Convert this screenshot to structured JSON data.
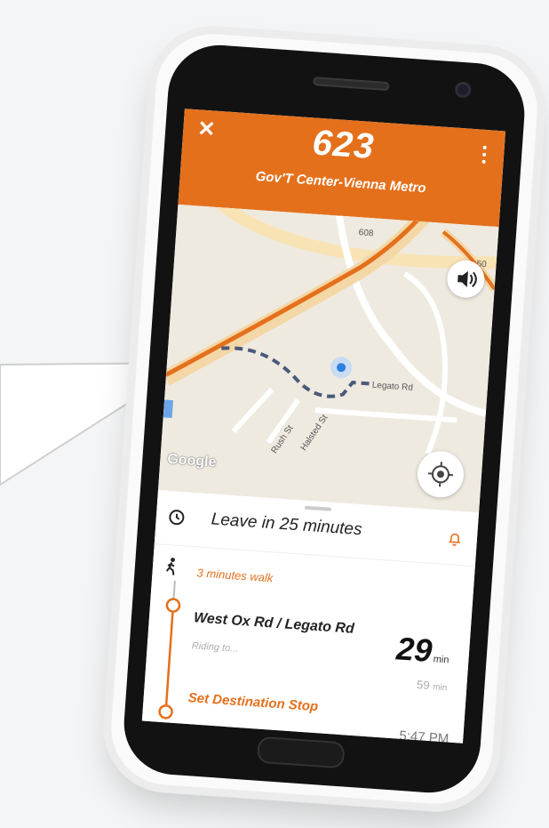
{
  "header": {
    "route_number": "623",
    "destination": "Gov'T Center-Vienna Metro",
    "close_symbol": "✕",
    "accent_color": "#e4701c"
  },
  "map": {
    "attribution": "Google",
    "road_labels": {
      "route_608": "608",
      "route_50": "50",
      "legato": "Legato Rd",
      "rush": "Rush St",
      "halsted": "Halsted St"
    },
    "icons": {
      "sound": "volume-icon",
      "locate": "my-location-icon"
    }
  },
  "departure": {
    "leave_text": "Leave in 25 minutes",
    "icons": {
      "clock": "clock-icon",
      "bell": "bell-icon"
    }
  },
  "trip": {
    "walk_text": "3 minutes walk",
    "stop_name": "West Ox Rd / Legato Rd",
    "riding_text": "Riding to...",
    "eta_minutes": "29",
    "eta_unit": "min",
    "next_eta": "59",
    "next_eta_unit": "min",
    "set_destination": "Set Destination Stop",
    "arrival_time": "5:47 PM"
  }
}
